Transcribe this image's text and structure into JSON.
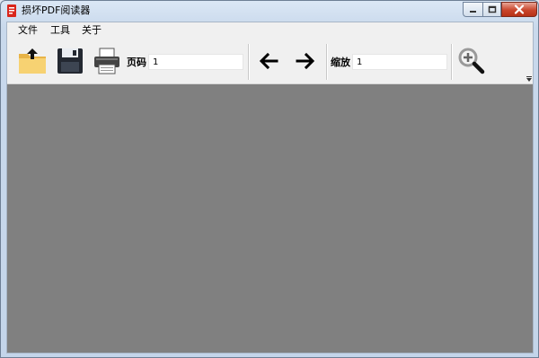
{
  "window": {
    "title": "损坏PDF阅读器",
    "controls": {
      "minimize": "minimize",
      "maximize": "maximize",
      "close": "close"
    }
  },
  "menu": {
    "items": [
      {
        "label": "文件"
      },
      {
        "label": "工具"
      },
      {
        "label": "关于"
      }
    ]
  },
  "toolbar": {
    "page_label": "页码",
    "page_value": "1",
    "zoom_label": "缩放",
    "zoom_value": "1"
  },
  "icons": {
    "open": "open-folder-icon",
    "save": "floppy-disk-icon",
    "print": "printer-icon",
    "prev": "arrow-left-icon",
    "next": "arrow-right-icon",
    "zoom": "zoom-in-icon"
  },
  "colors": {
    "viewer_background": "#808080",
    "client_background": "#f0f0f0",
    "close_button": "#c9462c"
  }
}
